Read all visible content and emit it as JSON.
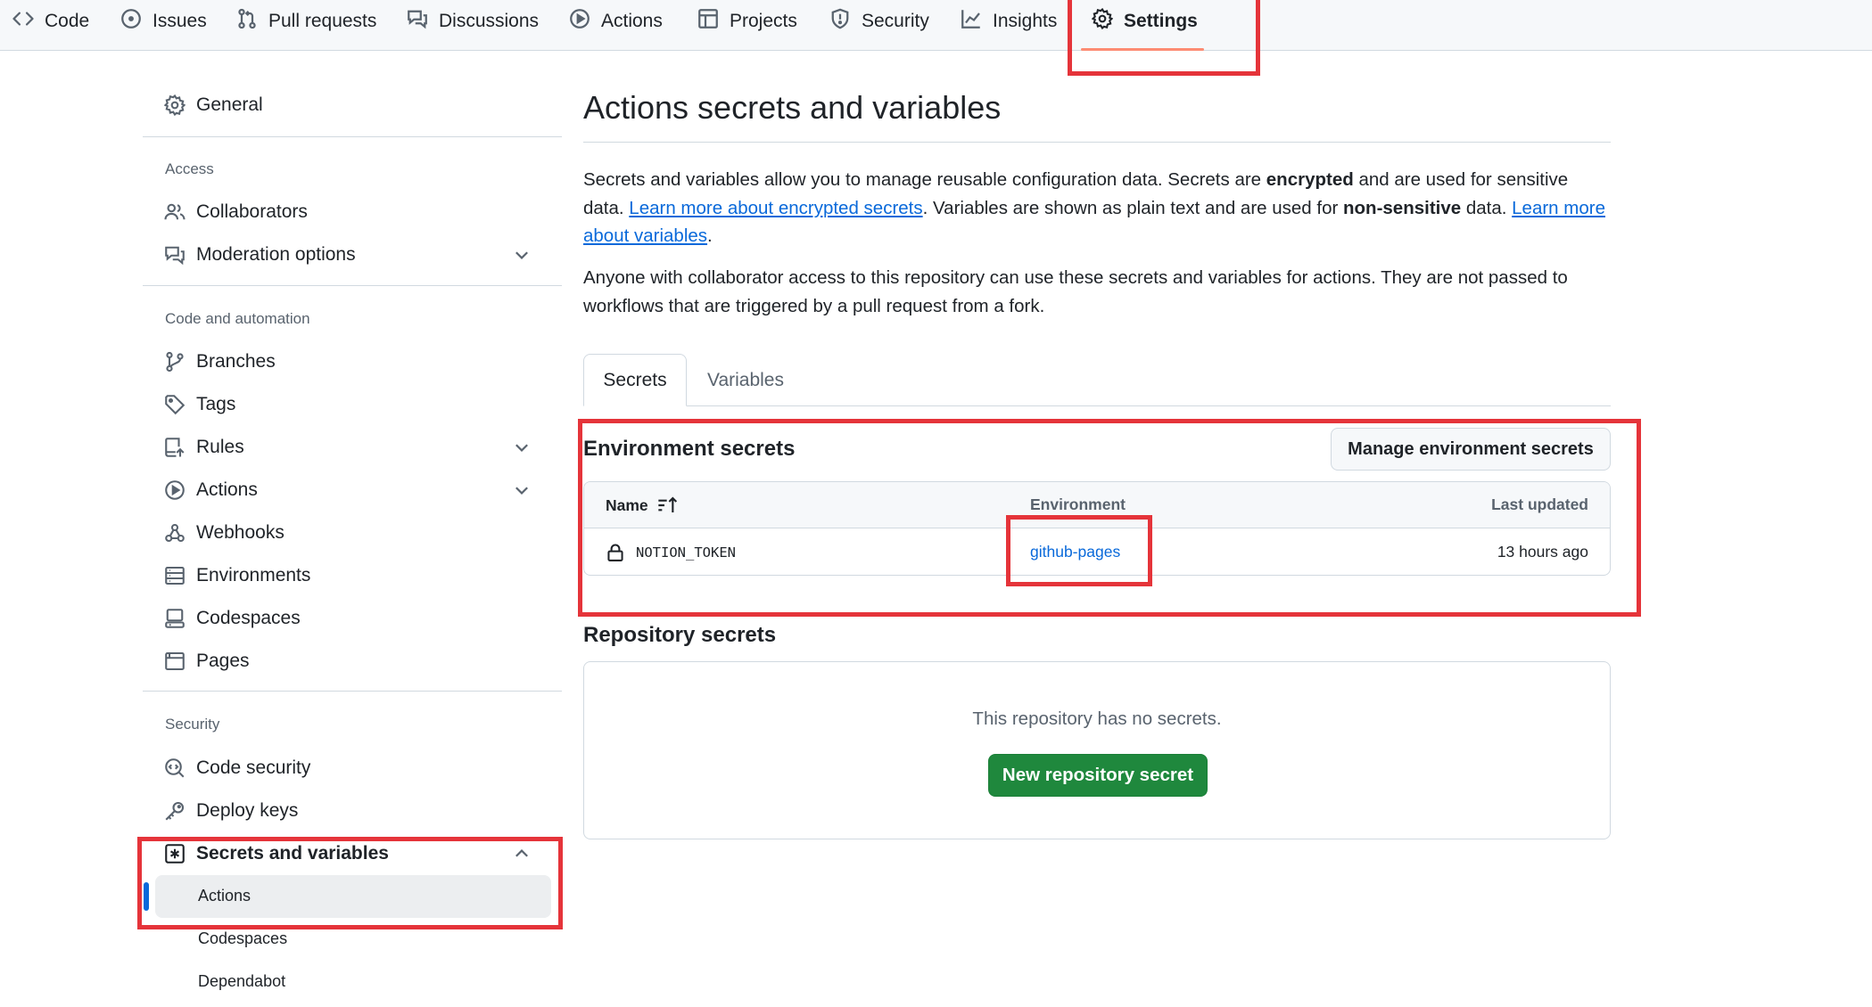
{
  "topnav": {
    "tabs": [
      {
        "label": "Code",
        "icon": "code-icon"
      },
      {
        "label": "Issues",
        "icon": "issue-opened-icon"
      },
      {
        "label": "Pull requests",
        "icon": "git-pull-request-icon"
      },
      {
        "label": "Discussions",
        "icon": "comment-discussion-icon"
      },
      {
        "label": "Actions",
        "icon": "play-icon"
      },
      {
        "label": "Projects",
        "icon": "table-icon"
      },
      {
        "label": "Security",
        "icon": "shield-icon"
      },
      {
        "label": "Insights",
        "icon": "graph-icon"
      },
      {
        "label": "Settings",
        "icon": "gear-icon",
        "selected": true
      }
    ]
  },
  "sidebar": {
    "general": "General",
    "access_heading": "Access",
    "access_items": [
      {
        "label": "Collaborators",
        "icon": "people-icon"
      },
      {
        "label": "Moderation options",
        "icon": "comment-discussion-icon",
        "expandable": true
      }
    ],
    "code_heading": "Code and automation",
    "code_items": [
      {
        "label": "Branches",
        "icon": "git-branch-icon"
      },
      {
        "label": "Tags",
        "icon": "tag-icon"
      },
      {
        "label": "Rules",
        "icon": "repo-push-icon",
        "expandable": true
      },
      {
        "label": "Actions",
        "icon": "play-icon",
        "expandable": true
      },
      {
        "label": "Webhooks",
        "icon": "webhook-icon"
      },
      {
        "label": "Environments",
        "icon": "server-icon"
      },
      {
        "label": "Codespaces",
        "icon": "codespaces-icon"
      },
      {
        "label": "Pages",
        "icon": "browser-icon"
      }
    ],
    "security_heading": "Security",
    "security_items": [
      {
        "label": "Code security",
        "icon": "codescan-icon"
      },
      {
        "label": "Deploy keys",
        "icon": "key-icon"
      },
      {
        "label": "Secrets and variables",
        "icon": "key-asterisk-icon",
        "expanded": true
      }
    ],
    "secrets_subitems": [
      {
        "label": "Actions",
        "active": true
      },
      {
        "label": "Codespaces"
      },
      {
        "label": "Dependabot"
      }
    ]
  },
  "main": {
    "title": "Actions secrets and variables",
    "intro": {
      "t1": "Secrets and variables allow you to manage reusable configuration data. Secrets are ",
      "b1": "encrypted",
      "t2": " and are used for sensitive data. ",
      "link1": "Learn more about encrypted secrets",
      "t3": ". Variables are shown as plain text and are used for ",
      "b2": "non-sensitive",
      "t4": " data. ",
      "link2": "Learn more about variables",
      "t5": "."
    },
    "notice": "Anyone with collaborator access to this repository can use these secrets and variables for actions. They are not passed to workflows that are triggered by a pull request from a fork.",
    "tabs": [
      "Secrets",
      "Variables"
    ],
    "env_secrets": {
      "title": "Environment secrets",
      "manage_button": "Manage environment secrets",
      "columns": {
        "name": "Name",
        "environment": "Environment",
        "updated": "Last updated"
      },
      "rows": [
        {
          "name": "NOTION_TOKEN",
          "environment": "github-pages",
          "updated": "13 hours ago"
        }
      ]
    },
    "repo_secrets": {
      "title": "Repository secrets",
      "empty_text": "This repository has no secrets.",
      "new_button": "New repository secret"
    }
  },
  "colors": {
    "accent": "#0969da",
    "primary_button": "#1f883d",
    "tab_underline": "#fd8c73",
    "annotation": "#e5343a"
  }
}
